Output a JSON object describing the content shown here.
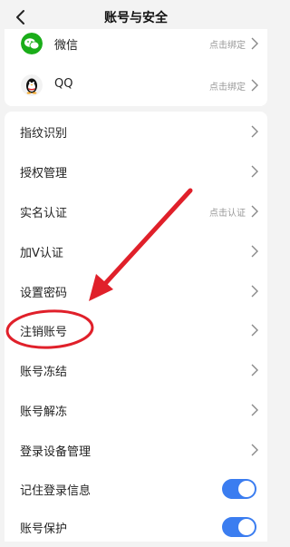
{
  "header": {
    "title": "账号与安全"
  },
  "bindings": [
    {
      "name": "微信",
      "status": "点击绑定",
      "icon": "wechat-icon"
    },
    {
      "name": "QQ",
      "status": "点击绑定",
      "icon": "qq-penguin-icon"
    }
  ],
  "settings": [
    {
      "label": "指纹识别"
    },
    {
      "label": "授权管理"
    },
    {
      "label": "实名认证",
      "status": "点击认证"
    },
    {
      "label": "加V认证"
    },
    {
      "label": "设置密码"
    },
    {
      "label": "注销账号"
    },
    {
      "label": "账号冻结"
    },
    {
      "label": "账号解冻"
    },
    {
      "label": "登录设备管理"
    },
    {
      "label": "记住登录信息",
      "toggle": true
    },
    {
      "label": "账号保护",
      "toggle": true
    }
  ],
  "colors": {
    "accent": "#3b7df0",
    "annotation": "#e0202a",
    "wechat": "#1aad19"
  }
}
